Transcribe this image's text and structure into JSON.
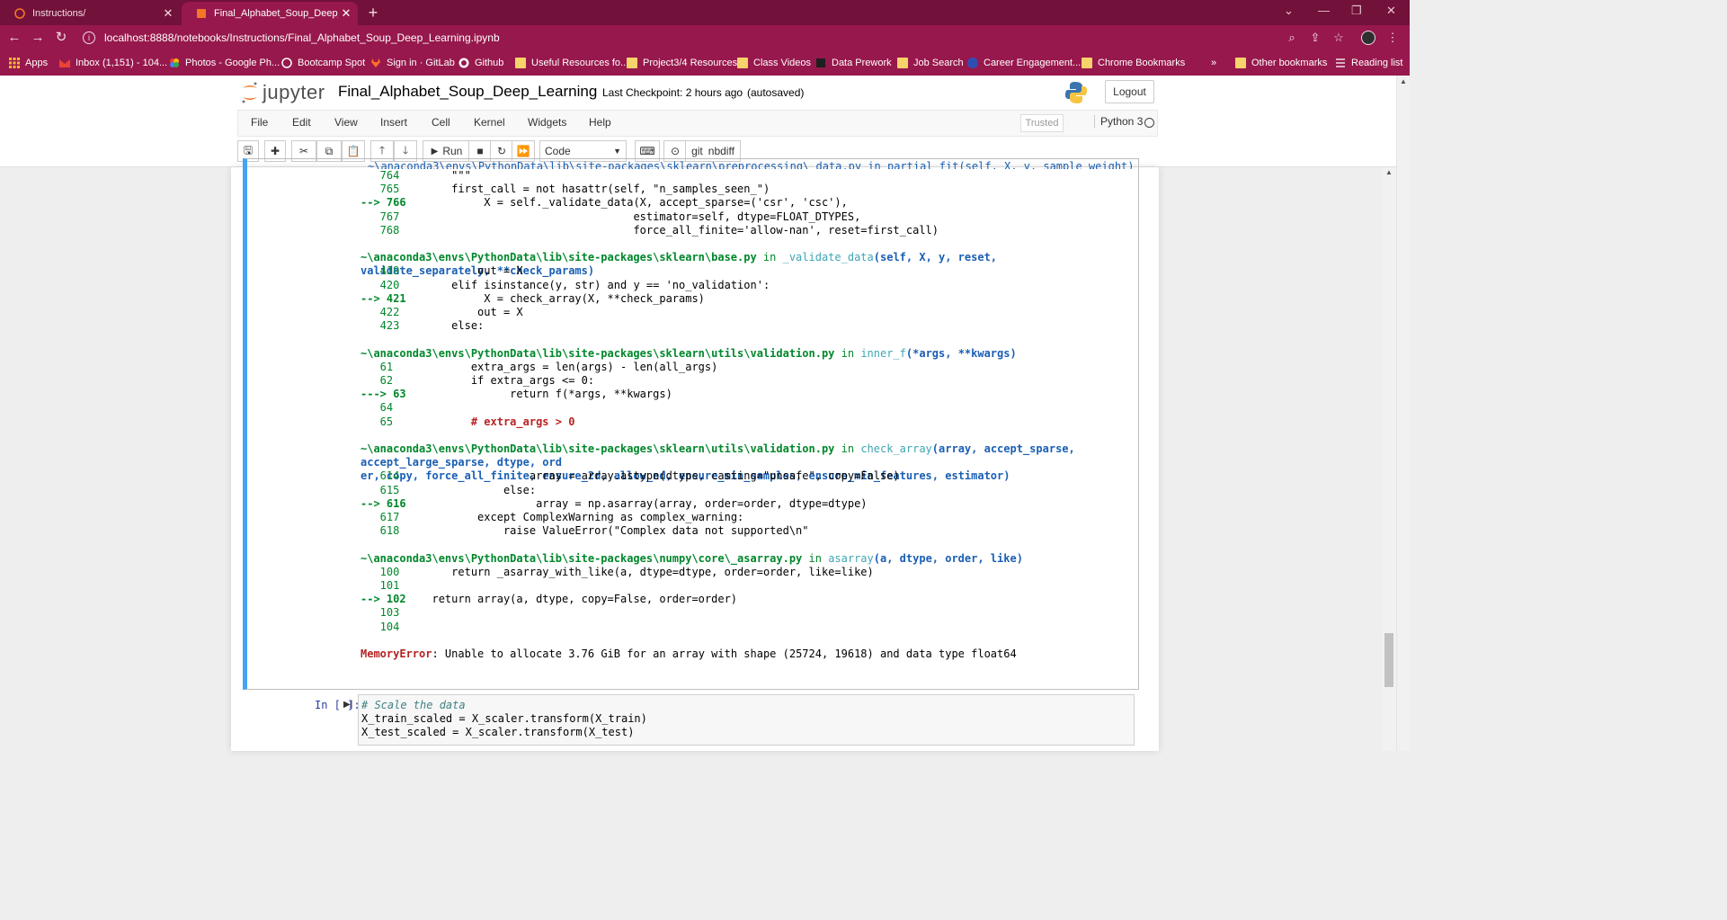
{
  "browser": {
    "tabs": [
      {
        "title": "Instructions/",
        "active": false
      },
      {
        "title": "Final_Alphabet_Soup_Deep_Lear",
        "active": true
      }
    ],
    "url": "localhost:8888/notebooks/Instructions/Final_Alphabet_Soup_Deep_Learning.ipynb",
    "bookmarks": [
      {
        "label": "Apps",
        "icon": "apps-grid-icon"
      },
      {
        "label": "Inbox (1,151) - 104...",
        "icon": "gmail-icon"
      },
      {
        "label": "Photos - Google Ph...",
        "icon": "google-photos-icon"
      },
      {
        "label": "Bootcamp Spot",
        "icon": "bootcamp-icon"
      },
      {
        "label": "Sign in · GitLab",
        "icon": "gitlab-icon"
      },
      {
        "label": "Github",
        "icon": "github-icon"
      },
      {
        "label": "Useful Resources fo...",
        "icon": "folder-icon"
      },
      {
        "label": "Project3/4 Resources",
        "icon": "folder-icon"
      },
      {
        "label": "Class Videos",
        "icon": "folder-icon"
      },
      {
        "label": "Data Prework",
        "icon": "book-icon"
      },
      {
        "label": "Job Search",
        "icon": "folder-icon"
      },
      {
        "label": "Career Engagement...",
        "icon": "2u-icon"
      },
      {
        "label": "Chrome Bookmarks",
        "icon": "folder-icon"
      }
    ],
    "overflow_label": "»",
    "other_bookmarks": "Other bookmarks",
    "reading_list": "Reading list"
  },
  "jupyter": {
    "logo_text": "jupyter",
    "notebook_name": "Final_Alphabet_Soup_Deep_Learning",
    "checkpoint": "Last Checkpoint: 2 hours ago",
    "autosaved": "(autosaved)",
    "logout": "Logout",
    "menu": [
      "File",
      "Edit",
      "View",
      "Insert",
      "Cell",
      "Kernel",
      "Widgets",
      "Help"
    ],
    "trusted": "Trusted",
    "kernel": "Python 3",
    "toolbar": {
      "run": "Run",
      "cell_type": "Code",
      "nbdiff": "nbdiff",
      "git": "git"
    }
  },
  "traceback": {
    "partial_header": "~\\anaconda3\\envs\\PythonData\\lib\\site-packages\\sklearn\\preprocessing\\_data.py in partial_fit(self, X, y, sample_weight)",
    "frames": [
      {
        "path": "",
        "fn": "",
        "sig": "",
        "lines": [
          {
            "num": "764",
            "arrow": "",
            "code": "        \"\"\""
          },
          {
            "num": "765",
            "arrow": "",
            "code": "        first_call = not hasattr(self, \"n_samples_seen_\")"
          },
          {
            "num": "766",
            "arrow": "-->",
            "code": "            X = self._validate_data(X, accept_sparse=('csr', 'csc'),"
          },
          {
            "num": "767",
            "arrow": "",
            "code": "                                    estimator=self, dtype=FLOAT_DTYPES,"
          },
          {
            "num": "768",
            "arrow": "",
            "code": "                                    force_all_finite='allow-nan', reset=first_call)"
          }
        ]
      },
      {
        "path": "~\\anaconda3\\envs\\PythonData\\lib\\site-packages\\sklearn\\base.py",
        "fn": "_validate_data",
        "sig": "(self, X, y, reset, validate_separately, **check_params)",
        "lines": [
          {
            "num": "419",
            "arrow": "",
            "code": "            out = X"
          },
          {
            "num": "420",
            "arrow": "",
            "code": "        elif isinstance(y, str) and y == 'no_validation':"
          },
          {
            "num": "421",
            "arrow": "-->",
            "code": "            X = check_array(X, **check_params)"
          },
          {
            "num": "422",
            "arrow": "",
            "code": "            out = X"
          },
          {
            "num": "423",
            "arrow": "",
            "code": "        else:"
          }
        ]
      },
      {
        "path": "~\\anaconda3\\envs\\PythonData\\lib\\site-packages\\sklearn\\utils\\validation.py",
        "fn": "inner_f",
        "sig": "(*args, **kwargs)",
        "lines": [
          {
            "num": "61",
            "arrow": "",
            "code": "            extra_args = len(args) - len(all_args)"
          },
          {
            "num": "62",
            "arrow": "",
            "code": "            if extra_args <= 0:"
          },
          {
            "num": "63",
            "arrow": "--->",
            "code": "                return f(*args, **kwargs)"
          },
          {
            "num": "64",
            "arrow": "",
            "code": ""
          },
          {
            "num": "65",
            "arrow": "",
            "code": "            # extra_args > 0"
          }
        ]
      },
      {
        "path": "~\\anaconda3\\envs\\PythonData\\lib\\site-packages\\sklearn\\utils\\validation.py",
        "fn": "check_array",
        "sig": "(array, accept_sparse, accept_large_sparse, dtype, ord\ner, copy, force_all_finite, ensure_2d, allow_nd, ensure_min_samples, ensure_min_features, estimator)",
        "lines": [
          {
            "num": "614",
            "arrow": "",
            "code": "                    array = array.astype(dtype, casting=\"unsafe\", copy=False)"
          },
          {
            "num": "615",
            "arrow": "",
            "code": "                else:"
          },
          {
            "num": "616",
            "arrow": "-->",
            "code": "                    array = np.asarray(array, order=order, dtype=dtype)"
          },
          {
            "num": "617",
            "arrow": "",
            "code": "            except ComplexWarning as complex_warning:"
          },
          {
            "num": "618",
            "arrow": "",
            "code": "                raise ValueError(\"Complex data not supported\\n\""
          }
        ]
      },
      {
        "path": "~\\anaconda3\\envs\\PythonData\\lib\\site-packages\\numpy\\core\\_asarray.py",
        "fn": "asarray",
        "sig": "(a, dtype, order, like)",
        "lines": [
          {
            "num": "100",
            "arrow": "",
            "code": "        return _asarray_with_like(a, dtype=dtype, order=order, like=like)"
          },
          {
            "num": "101",
            "arrow": "",
            "code": ""
          },
          {
            "num": "102",
            "arrow": "-->",
            "code": "    return array(a, dtype, copy=False, order=order)"
          },
          {
            "num": "103",
            "arrow": "",
            "code": ""
          },
          {
            "num": "104",
            "arrow": "",
            "code": ""
          }
        ]
      }
    ],
    "error_name": "MemoryError",
    "error_message": ": Unable to allocate 3.76 GiB for an array with shape (25724, 19618) and data type float64"
  },
  "next_cell": {
    "prompt": "In [ ]:",
    "code": [
      "# Scale the data",
      "X_train_scaled = X_scaler.transform(X_train)",
      "X_test_scaled = X_scaler.transform(X_test)"
    ]
  },
  "colors": {
    "chrome_frame": "#72113a",
    "chrome_toolbar": "#97184c",
    "selected_cell_border": "#42a5f5"
  }
}
